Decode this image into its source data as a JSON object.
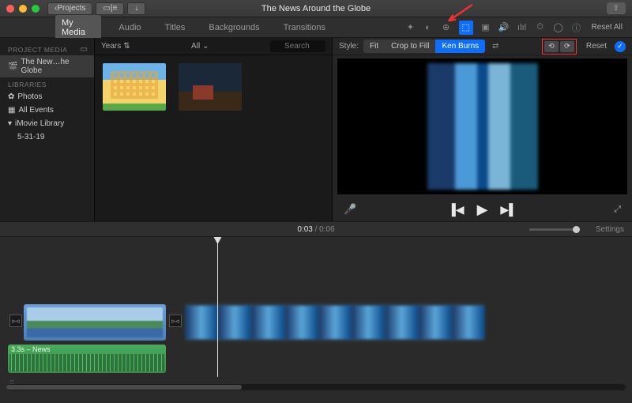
{
  "titlebar": {
    "back_label": "Projects",
    "title": "The News Around the Globe"
  },
  "tabs": {
    "items": [
      "My Media",
      "Audio",
      "Titles",
      "Backgrounds",
      "Transitions"
    ],
    "active": 0,
    "reset_all": "Reset All"
  },
  "sidebar": {
    "project_media_hdr": "PROJECT MEDIA",
    "project_name": "The New…he Globe",
    "libraries_hdr": "LIBRARIES",
    "photos": "Photos",
    "all_events": "All Events",
    "imovie_lib": "iMovie Library",
    "event_date": "5-31-19"
  },
  "browser": {
    "filter": "Years",
    "clip_filter": "All",
    "search_placeholder": "Search"
  },
  "style": {
    "label": "Style:",
    "fit": "Fit",
    "crop": "Crop to Fill",
    "ken": "Ken Burns",
    "reset": "Reset"
  },
  "timeline": {
    "current": "0:03",
    "total": "0:06",
    "settings": "Settings",
    "audio_clip_label": "3.3s – News"
  }
}
